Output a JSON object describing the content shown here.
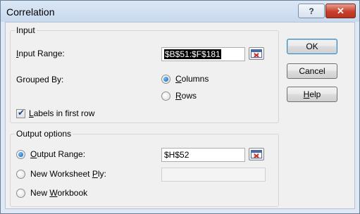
{
  "window": {
    "title": "Correlation",
    "help_glyph": "?",
    "close_glyph": "✕"
  },
  "input_group": {
    "legend": "Input",
    "input_range_label": "Input Range:",
    "input_range_accel": "I",
    "input_range_rest": "nput Range:",
    "input_range_value": "$B$51:$F$181",
    "grouped_by_label": "Grouped By:",
    "columns_accel": "C",
    "columns_rest": "olumns",
    "rows_accel": "R",
    "rows_rest": "ows",
    "labels_accel": "L",
    "labels_rest": "abels in first row",
    "grouped_by_selected": "Columns",
    "labels_checked": true
  },
  "output_group": {
    "legend": "Output options",
    "output_range_accel": "O",
    "output_range_rest": "utput Range:",
    "output_range_value": "$H$52",
    "new_ply_pre": "New Worksheet ",
    "new_ply_accel": "P",
    "new_ply_rest": "ly:",
    "new_ply_value": "",
    "new_workbook_pre": "New ",
    "new_workbook_accel": "W",
    "new_workbook_rest": "orkbook",
    "selected": "Output Range"
  },
  "buttons": {
    "ok": "OK",
    "cancel": "Cancel",
    "help_accel": "H",
    "help_rest": "elp"
  },
  "icons": {
    "refedit": "range-selector-icon",
    "help": "question-mark-icon",
    "close": "close-icon"
  }
}
